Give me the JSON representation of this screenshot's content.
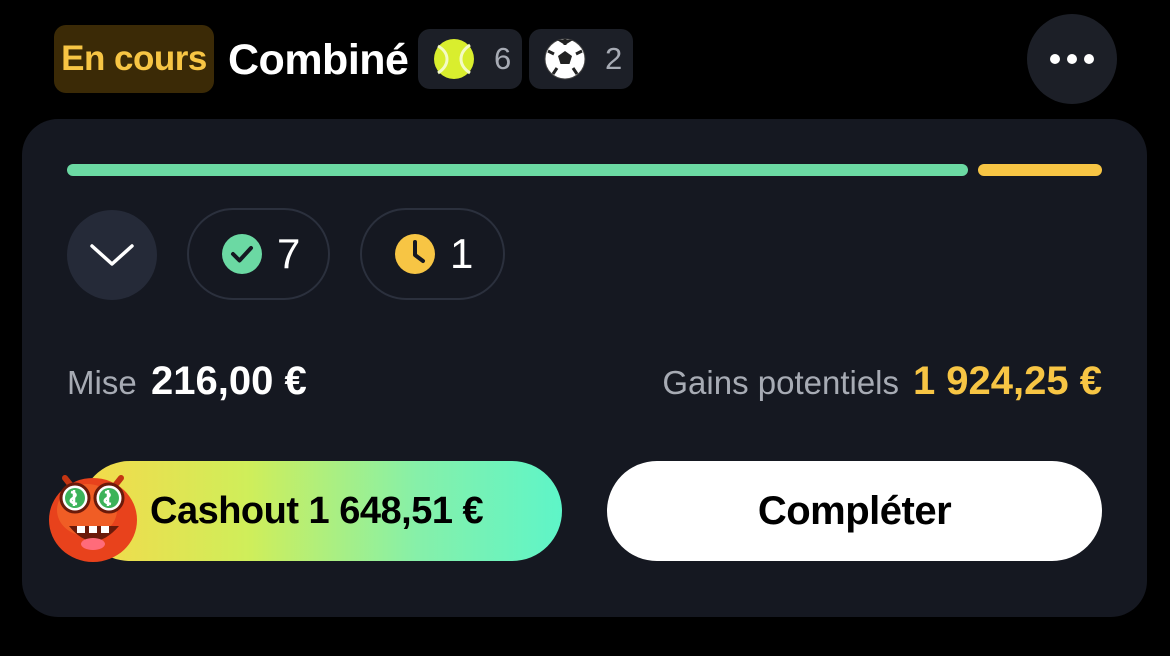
{
  "header": {
    "status": "En cours",
    "title": "Combiné",
    "sports": [
      {
        "icon": "tennis-ball-icon",
        "count": "6"
      },
      {
        "icon": "soccer-ball-icon",
        "count": "2"
      }
    ],
    "more_icon": "more-dots-icon"
  },
  "progress": {
    "won_fraction": 0.875,
    "pending_fraction": 0.125,
    "colors": {
      "won": "#6bd9a3",
      "pending": "#f7c544"
    }
  },
  "selections": {
    "expand_icon": "chevron-down-icon",
    "won": {
      "icon": "check-circle-icon",
      "count": "7"
    },
    "pending": {
      "icon": "clock-icon",
      "count": "1"
    }
  },
  "stake": {
    "label": "Mise",
    "value": "216,00 €"
  },
  "potential": {
    "label": "Gains potentiels",
    "value": "1 924,25 €"
  },
  "actions": {
    "cashout_label": "Cashout 1 648,51 €",
    "complete_label": "Compléter"
  },
  "colors": {
    "background": "#000000",
    "card": "#151821",
    "accent_yellow": "#f7c544",
    "accent_green": "#6bd9a3"
  }
}
